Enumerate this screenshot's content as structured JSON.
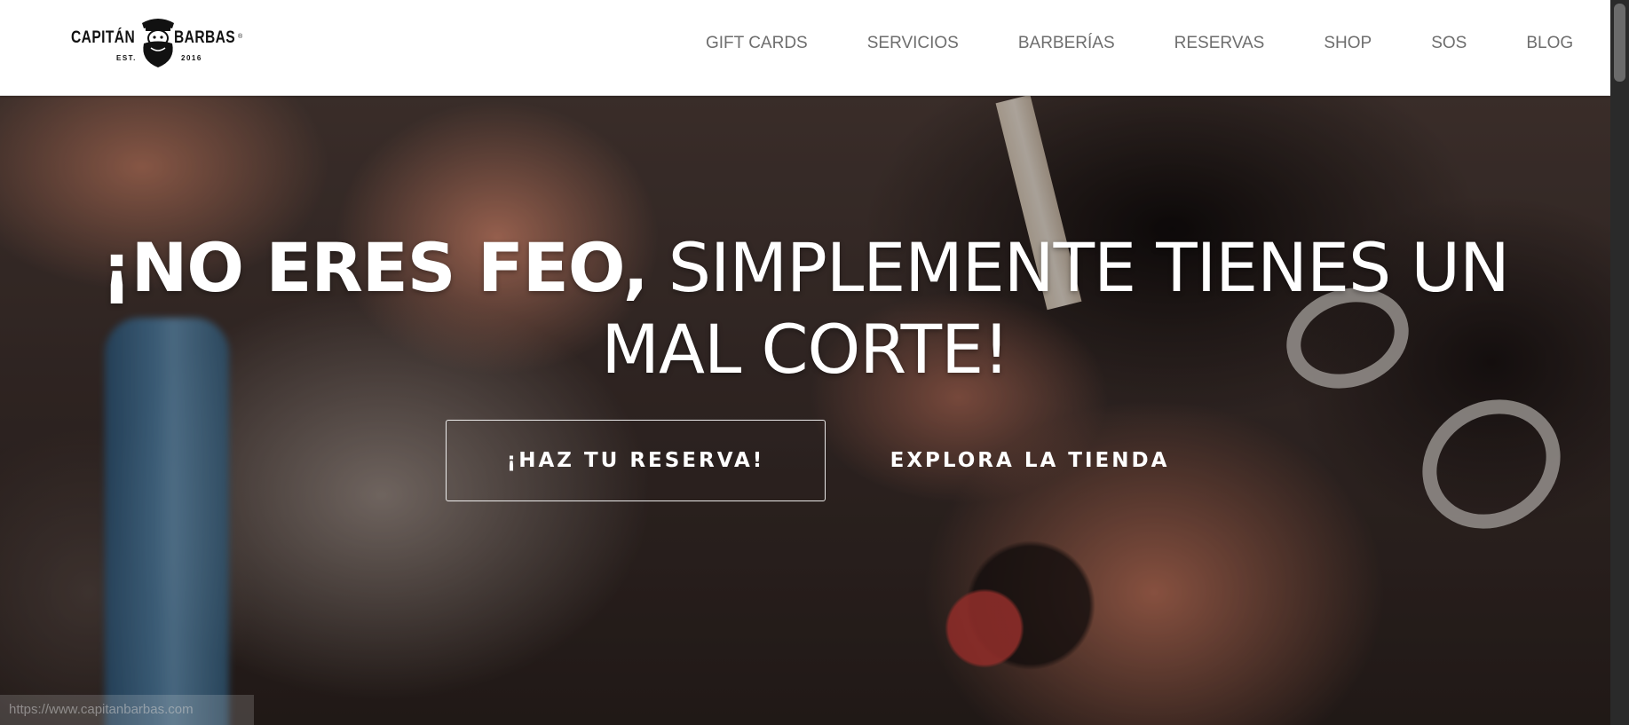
{
  "logo": {
    "word_left": "CAPITÁN",
    "word_right": "BARBAS",
    "registered": "®",
    "est_label": "EST.",
    "est_year": "2016"
  },
  "nav": {
    "items": [
      {
        "label": "GIFT CARDS"
      },
      {
        "label": "SERVICIOS"
      },
      {
        "label": "BARBERÍAS"
      },
      {
        "label": "RESERVAS"
      },
      {
        "label": "SHOP"
      },
      {
        "label": "SOS"
      },
      {
        "label": "BLOG"
      }
    ]
  },
  "hero": {
    "headline_strong": "¡NO ERES FEO,",
    "headline_light_1": " SIMPLEMENTE TIENES UN",
    "headline_light_2": "MAL CORTE!",
    "reserve_button": "¡HAZ TU RESERVA!",
    "shop_button": "EXPLORA LA TIENDA"
  },
  "status_bar": {
    "url": "https://www.capitanbarbas.com"
  },
  "colors": {
    "header_bg": "#ffffff",
    "nav_text": "#6e6e6e",
    "hero_text": "#ffffff"
  }
}
